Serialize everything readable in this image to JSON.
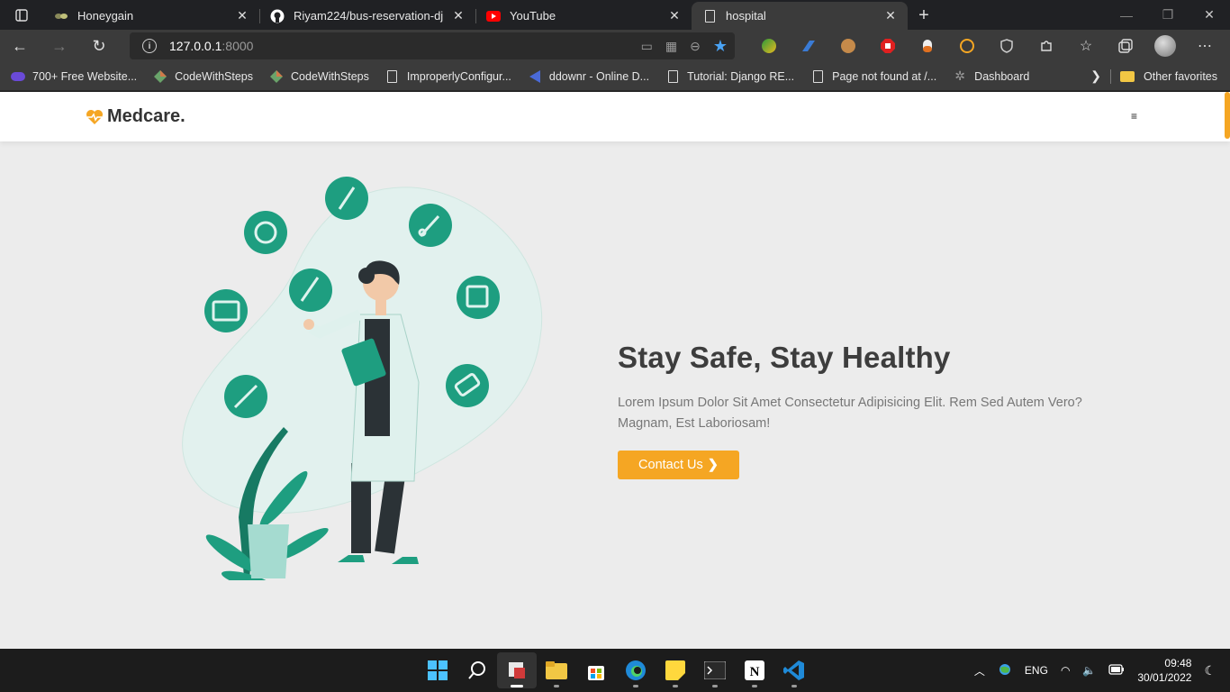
{
  "browser": {
    "tabs": [
      {
        "title": "Honeygain",
        "icon": "honeygain-icon"
      },
      {
        "title": "Riyam224/bus-reservation-dj",
        "icon": "github-icon"
      },
      {
        "title": "YouTube",
        "icon": "youtube-icon"
      },
      {
        "title": "hospital",
        "icon": "page-icon",
        "active": true
      }
    ],
    "url_host": "127.0.0.1",
    "url_port": ":8000",
    "favorites": [
      {
        "label": "700+ Free Website...",
        "icon": "colorlib-icon"
      },
      {
        "label": "CodeWithSteps",
        "icon": "diamond-icon"
      },
      {
        "label": "CodeWithSteps",
        "icon": "diamond-icon"
      },
      {
        "label": "ImproperlyConfigur...",
        "icon": "page-icon"
      },
      {
        "label": "ddownr - Online D...",
        "icon": "ddownr-icon"
      },
      {
        "label": "Tutorial: Django RE...",
        "icon": "page-icon"
      },
      {
        "label": "Page not found at /...",
        "icon": "page-icon"
      },
      {
        "label": "Dashboard",
        "icon": "gear-icon"
      }
    ],
    "other_favorites": "Other favorites"
  },
  "site": {
    "logo_text": "Medcare.",
    "menu_icon": "≡",
    "hero": {
      "title": "Stay Safe, Stay Healthy",
      "description": "Lorem Ipsum Dolor Sit Amet Consectetur Adipisicing Elit. Rem Sed Autem Vero? Magnam, Est Laboriosam!",
      "button_label": "Contact Us"
    }
  },
  "colors": {
    "accent": "#f5a623",
    "teal": "#1e9e80",
    "page_bg": "#ececec"
  },
  "taskbar": {
    "language": "ENG",
    "time": "09:48",
    "date": "30/01/2022"
  }
}
